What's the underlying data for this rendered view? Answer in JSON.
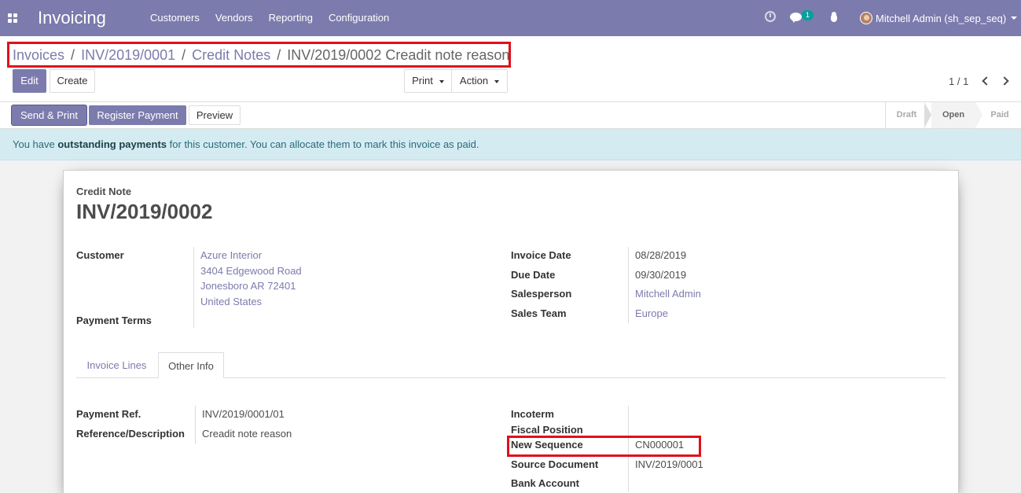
{
  "navbar": {
    "app_name": "Invoicing",
    "menu": [
      "Customers",
      "Vendors",
      "Reporting",
      "Configuration"
    ],
    "chat_badge": "1",
    "user": "Mitchell Admin (sh_sep_seq)"
  },
  "breadcrumb": {
    "items": [
      "Invoices",
      "INV/2019/0001",
      "Credit Notes"
    ],
    "separator": "/",
    "current": "INV/2019/0002 Creadit note reason"
  },
  "toolbar": {
    "edit": "Edit",
    "create": "Create",
    "print": "Print",
    "action": "Action",
    "pager": "1 / 1"
  },
  "header_buttons": {
    "send_print": "Send & Print",
    "register_payment": "Register Payment",
    "preview": "Preview"
  },
  "status_stages": [
    "Draft",
    "Open",
    "Paid"
  ],
  "alert": {
    "prefix": "You have ",
    "bold": "outstanding payments",
    "suffix": " for this customer. You can allocate them to mark this invoice as paid."
  },
  "document": {
    "type_label": "Credit Note",
    "number": "INV/2019/0002"
  },
  "fields": {
    "customer_label": "Customer",
    "customer_lines": [
      "Azure Interior",
      "3404 Edgewood Road",
      "Jonesboro AR 72401",
      "United States"
    ],
    "payment_terms_label": "Payment Terms",
    "invoice_date_label": "Invoice Date",
    "invoice_date": "08/28/2019",
    "due_date_label": "Due Date",
    "due_date": "09/30/2019",
    "salesperson_label": "Salesperson",
    "salesperson": "Mitchell Admin",
    "sales_team_label": "Sales Team",
    "sales_team": "Europe"
  },
  "tabs": [
    "Invoice Lines",
    "Other Info"
  ],
  "other_info": {
    "payment_ref_label": "Payment Ref.",
    "payment_ref": "INV/2019/0001/01",
    "reference_label": "Reference/Description",
    "reference": "Creadit note reason",
    "incoterm_label": "Incoterm",
    "fiscal_position_label": "Fiscal Position",
    "new_sequence_label": "New Sequence",
    "new_sequence": "CN000001",
    "source_document_label": "Source Document",
    "source_document": "INV/2019/0001",
    "bank_account_label": "Bank Account"
  },
  "colors": {
    "brand": "#7c7bad",
    "highlight": "#e0101a",
    "alert_bg": "#d4ecf1"
  }
}
